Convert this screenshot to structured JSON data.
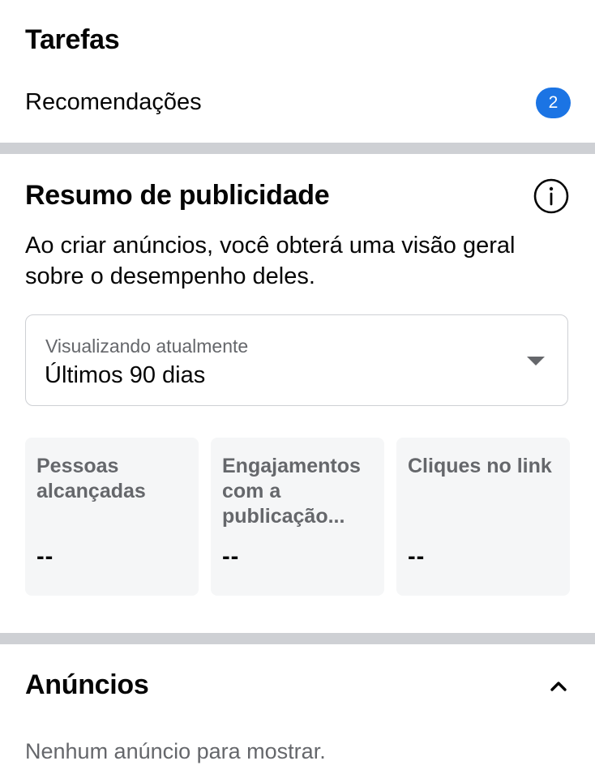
{
  "tasks": {
    "title": "Tarefas",
    "recommendations_label": "Recomendações",
    "recommendations_count": "2"
  },
  "ad_summary": {
    "title": "Resumo de publicidade",
    "info_icon": "info-icon",
    "description": "Ao criar anúncios, você obterá uma visão geral sobre o desempenho deles.",
    "period": {
      "label": "Visualizando atualmente",
      "value": "Últimos 90 dias"
    },
    "metrics": [
      {
        "label": "Pessoas alcançadas",
        "value": "--"
      },
      {
        "label": "Engajamentos com a publicação...",
        "value": "--"
      },
      {
        "label": "Cliques no link",
        "value": "--"
      }
    ]
  },
  "ads": {
    "title": "Anúncios",
    "empty_message": "Nenhum anúncio para mostrar."
  },
  "colors": {
    "badge": "#1b74e4",
    "divider": "#ced0d4",
    "card_background": "#f5f6f7",
    "secondary_text": "#65676b"
  }
}
